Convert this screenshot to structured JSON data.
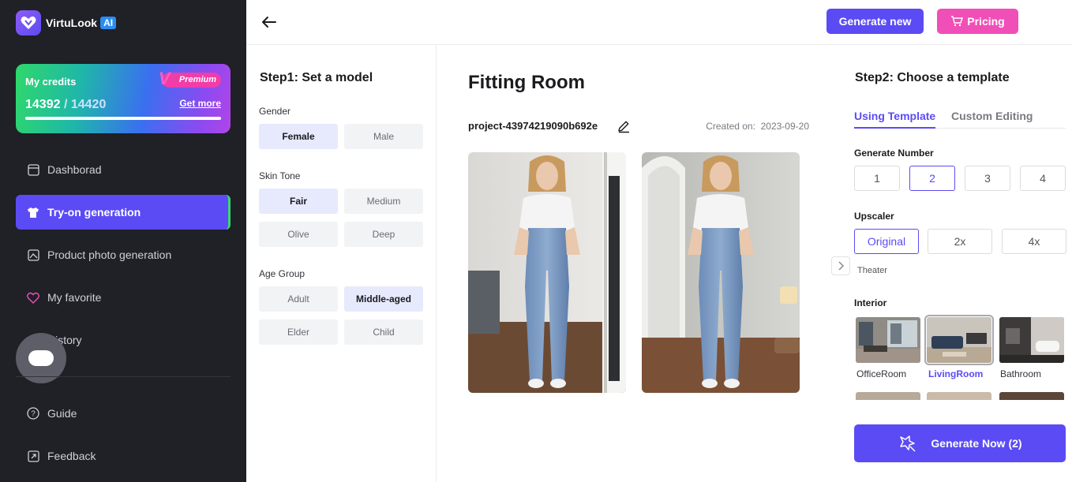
{
  "app": {
    "name": "VirtuLook",
    "badge": "AI"
  },
  "credits": {
    "title": "My credits",
    "premium": "Premium",
    "used": "14392",
    "separator": " / ",
    "total": "14420",
    "get_more": "Get more",
    "fraction": 0.998
  },
  "nav": {
    "dashboard": "Dashborad",
    "tryon": "Try-on generation",
    "product": "Product photo generation",
    "favorite": "My favorite",
    "history": "History",
    "guide": "Guide",
    "feedback": "Feedback"
  },
  "topbar": {
    "generate_new": "Generate new",
    "pricing": "Pricing"
  },
  "step1": {
    "title": "Step1: Set a model",
    "gender": {
      "label": "Gender",
      "options": [
        "Female",
        "Male"
      ],
      "selected": "Female"
    },
    "skin": {
      "label": "Skin Tone",
      "options": [
        "Fair",
        "Medium",
        "Olive",
        "Deep"
      ],
      "selected": "Fair"
    },
    "age": {
      "label": "Age Group",
      "options": [
        "Adult",
        "Middle-aged",
        "Elder",
        "Child"
      ],
      "selected": "Middle-aged"
    }
  },
  "center": {
    "title": "Fitting Room",
    "project": "project-43974219090b692e",
    "created_label": "Created on:",
    "created_date": "2023-09-20"
  },
  "step2": {
    "title": "Step2: Choose a template",
    "tabs": [
      "Using Template",
      "Custom Editing"
    ],
    "generate_number": {
      "label": "Generate Number",
      "options": [
        "1",
        "2",
        "3",
        "4"
      ],
      "selected": "2"
    },
    "upscaler": {
      "label": "Upscaler",
      "options": [
        "Original",
        "2x",
        "4x"
      ],
      "selected": "Original"
    },
    "theater": "Theater",
    "interior": {
      "label": "Interior",
      "items": [
        "OfficeRoom",
        "LivingRoom",
        "Bathroom"
      ],
      "selected": "LivingRoom"
    },
    "generate_now": "Generate Now (2)"
  },
  "colors": {
    "accent": "#5b4bf5",
    "pink": "#f04fb7",
    "sidebar": "#202027",
    "active_edge": "#39d873"
  }
}
